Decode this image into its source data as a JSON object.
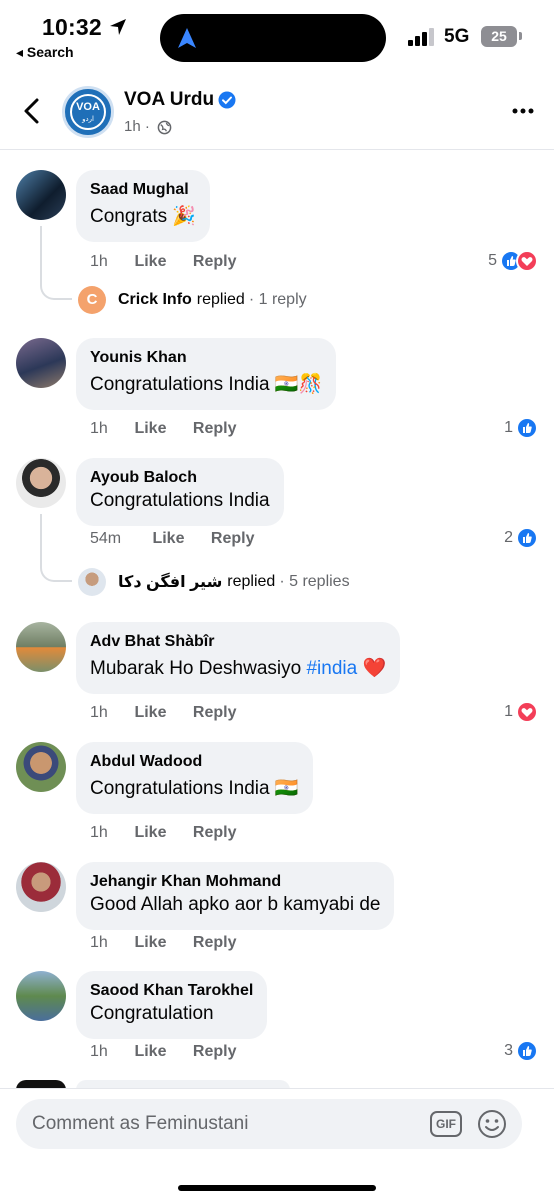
{
  "status_bar": {
    "time": "10:32",
    "back_app": "◂ Search",
    "network": "5G",
    "battery": "25"
  },
  "header": {
    "page_name": "VOA Urdu",
    "logo_text": "VOA",
    "logo_urdu": "اردو",
    "meta": "1h ·"
  },
  "comments": [
    {
      "author": "Saad Mughal",
      "text": "Congrats 🎉",
      "time": "1h",
      "like": "Like",
      "reply": "Reply",
      "reaction_count": "5",
      "reply_preview": {
        "name": "Crick Info",
        "verb": "replied",
        "count": "· 1 reply",
        "initial": "C"
      }
    },
    {
      "author": "Younis Khan",
      "text": "Congratulations India 🇮🇳🎊",
      "time": "1h",
      "like": "Like",
      "reply": "Reply",
      "reaction_count": "1"
    },
    {
      "author": "Ayoub Baloch",
      "text": "Congratulations India",
      "time": "54m",
      "like": "Like",
      "reply": "Reply",
      "reaction_count": "2",
      "reply_preview": {
        "name": "شیر افگن دکا",
        "verb": "replied",
        "count": "· 5 replies"
      }
    },
    {
      "author": "Adv Bhat Shàbîr",
      "text": "Mubarak Ho Deshwasiyo",
      "hashtag": "#india",
      "emoji": "❤️",
      "time": "1h",
      "like": "Like",
      "reply": "Reply",
      "reaction_count": "1"
    },
    {
      "author": "Abdul Wadood",
      "text": "Congratulations India 🇮🇳",
      "time": "1h",
      "like": "Like",
      "reply": "Reply"
    },
    {
      "author": "Jehangir Khan Mohmand",
      "text": "Good Allah apko aor b kamyabi de",
      "time": "1h",
      "like": "Like",
      "reply": "Reply"
    },
    {
      "author": "Saood Khan Tarokhel",
      "text": "Congratulation",
      "time": "1h",
      "like": "Like",
      "reply": "Reply",
      "reaction_count": "3"
    }
  ],
  "composer": {
    "placeholder": "Comment as Feminustani",
    "gif_label": "GIF"
  },
  "colors": {
    "facebook_blue": "#1877f2",
    "love_red": "#f33e58",
    "bubble_gray": "#f0f2f5",
    "secondary_text": "#65676b"
  }
}
